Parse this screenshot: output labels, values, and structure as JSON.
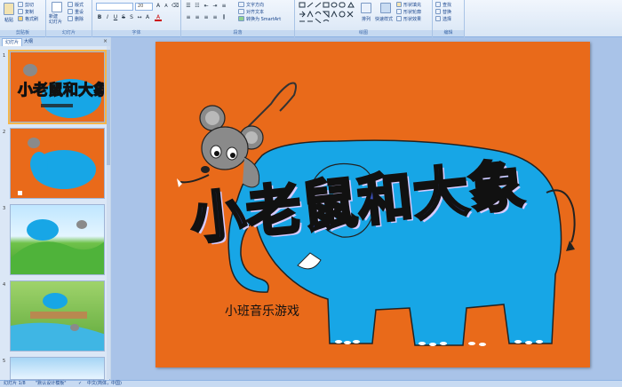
{
  "ribbon": {
    "clipboard": {
      "label": "剪贴板",
      "paste": "粘贴",
      "cut": "剪切",
      "copy": "复制",
      "format_painter": "格式刷"
    },
    "slides": {
      "label": "幻灯片",
      "new_slide": "新建\n幻灯片",
      "layout": "版式",
      "reset": "重设",
      "delete": "删除"
    },
    "font": {
      "label": "字体",
      "font_name": "",
      "font_size": "20"
    },
    "paragraph": {
      "label": "段落",
      "text_direction": "文字方向",
      "align_text": "对齐文本",
      "smartart": "转换为 SmartArt"
    },
    "drawing": {
      "label": "绘图",
      "arrange": "排列",
      "quick_styles": "快速样式",
      "shape_fill": "形状填充",
      "shape_outline": "形状轮廓",
      "shape_effects": "形状效果"
    },
    "editing": {
      "label": "编辑",
      "find": "查找",
      "replace": "替换",
      "select": "选择"
    }
  },
  "panel": {
    "tabs": [
      "幻灯片",
      "大纲"
    ],
    "close": "×",
    "thumbnails": [
      {
        "num": "1",
        "selected": true
      },
      {
        "num": "2",
        "selected": false
      },
      {
        "num": "3",
        "selected": false
      },
      {
        "num": "4",
        "selected": false
      },
      {
        "num": "5",
        "selected": false
      }
    ]
  },
  "slide": {
    "title": "小老鼠和大象",
    "subtitle": "小班音乐游戏",
    "background": "#e96a1a",
    "elephant_color": "#17a6e6"
  },
  "status": {
    "slide_count": "幻灯片 1/8",
    "theme": "\"默认设计模板\"",
    "language": "中文(简体，中国)"
  }
}
